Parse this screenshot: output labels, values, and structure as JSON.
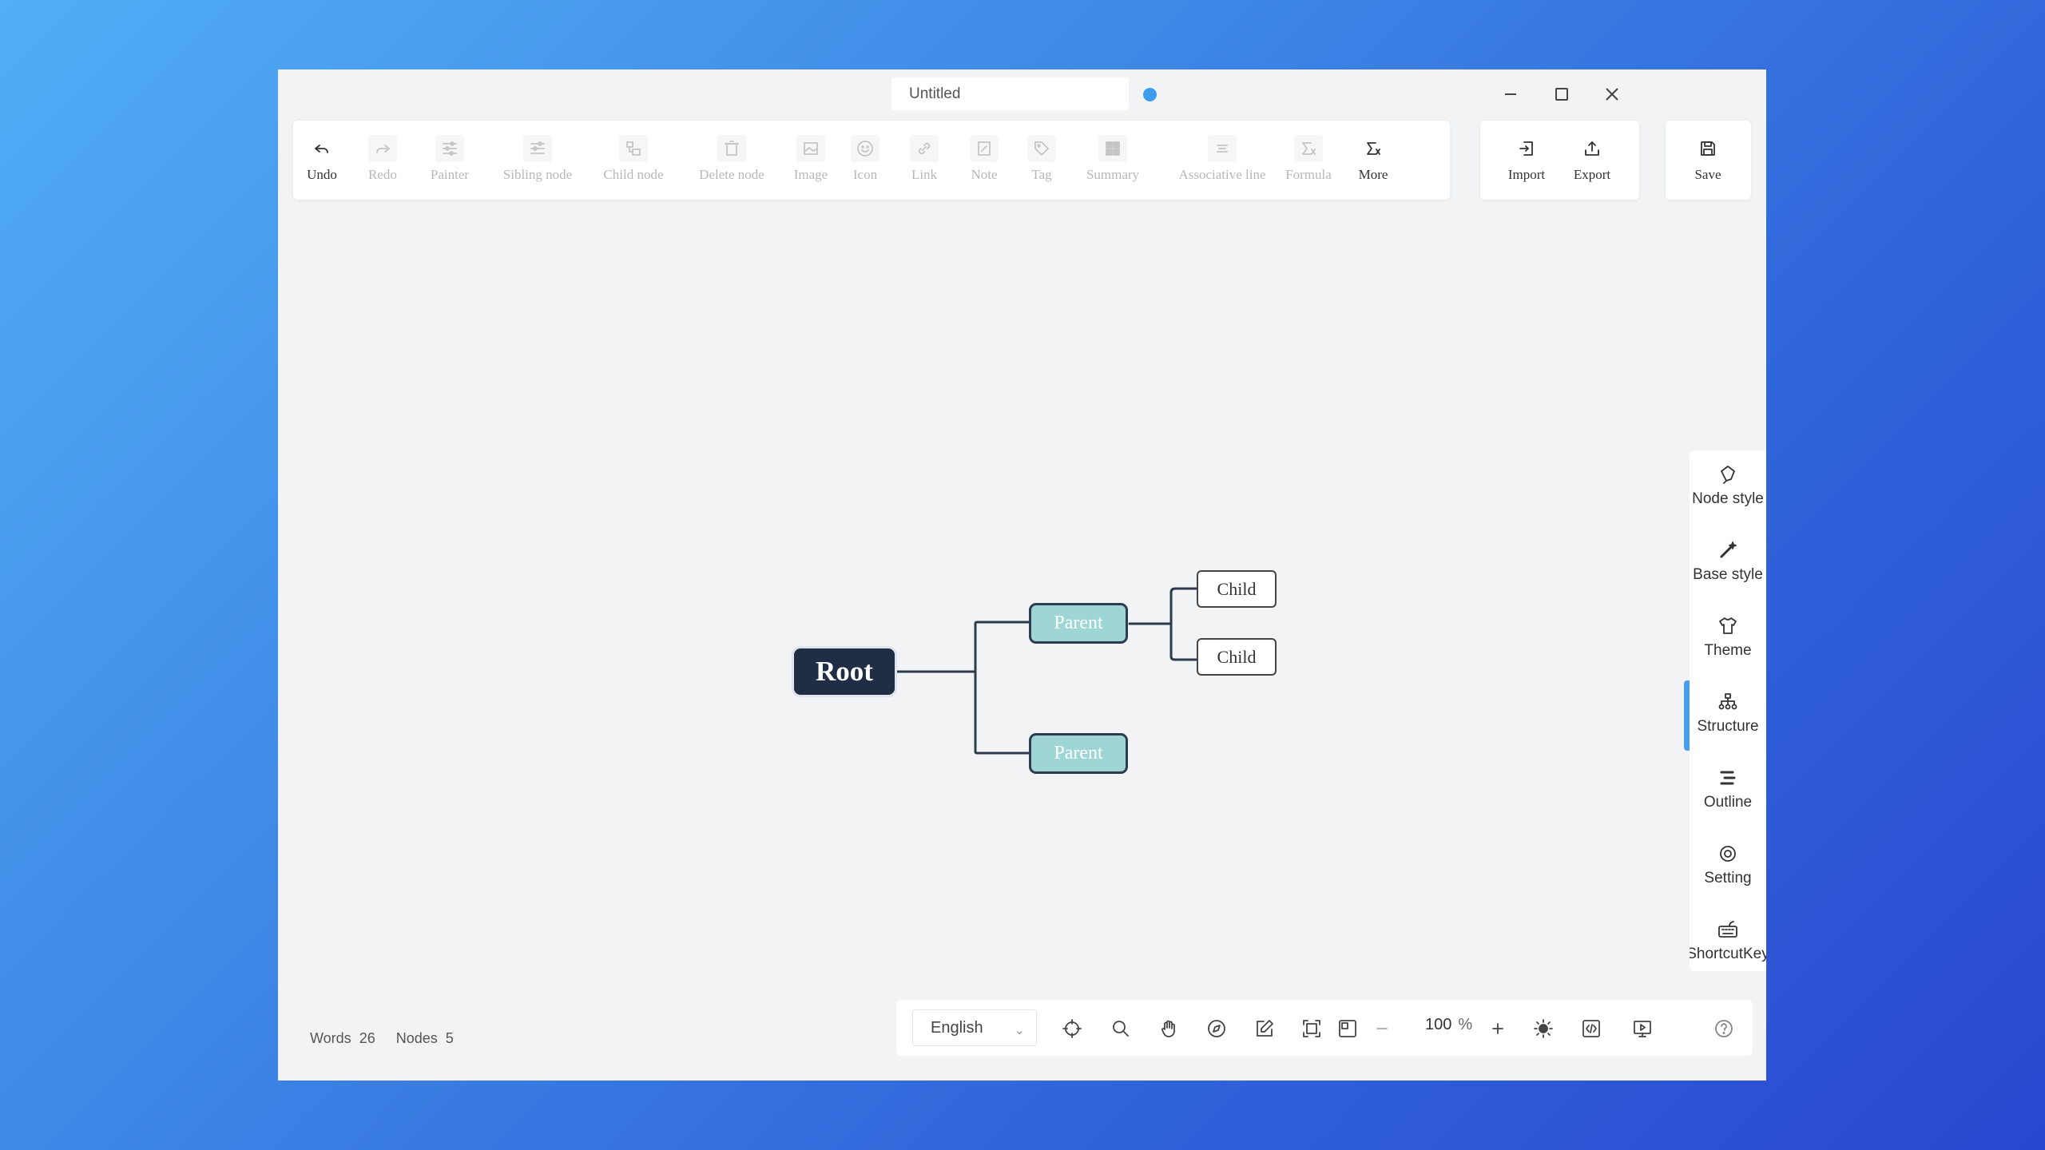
{
  "document": {
    "title": "Untitled"
  },
  "toolbar": {
    "undo": "Undo",
    "redo": "Redo",
    "painter": "Painter",
    "sibling_node": "Sibling node",
    "child_node": "Child node",
    "delete_node": "Delete node",
    "image": "Image",
    "icon": "Icon",
    "link": "Link",
    "note": "Note",
    "tag": "Tag",
    "summary": "Summary",
    "associative_line": "Associative line",
    "formula": "Formula",
    "more": "More",
    "import": "Import",
    "export": "Export",
    "save": "Save"
  },
  "mindmap": {
    "root": "Root",
    "parents": [
      "Parent",
      "Parent"
    ],
    "children": [
      "Child",
      "Child"
    ]
  },
  "sidebar": {
    "items": [
      "Node style",
      "Base style",
      "Theme",
      "Structure",
      "Outline",
      "Setting",
      "ShortcutKey"
    ],
    "active": "Structure"
  },
  "status": {
    "words_label": "Words",
    "words": "26",
    "nodes_label": "Nodes",
    "nodes": "5"
  },
  "bottombar": {
    "language": "English",
    "zoom": "100",
    "zoom_unit": "%"
  },
  "colors": {
    "accent": "#3d9ef0",
    "root_bg": "#1f2d45",
    "parent_bg": "#9ed6d6"
  }
}
